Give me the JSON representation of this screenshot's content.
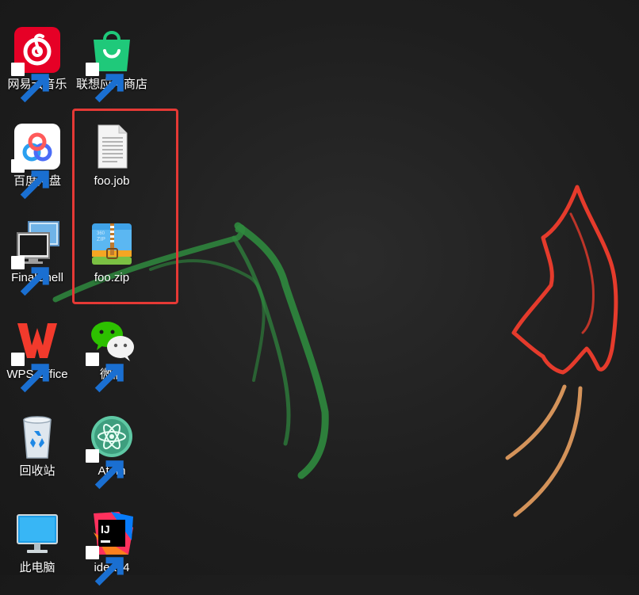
{
  "desktop": {
    "icons": [
      {
        "label": "网易云音乐",
        "icon": "netease-music-icon",
        "shortcut": true
      },
      {
        "label": "联想应用商店",
        "icon": "lenovo-store-icon",
        "shortcut": true
      },
      {
        "label": "百度网盘",
        "icon": "baidu-netdisk-icon",
        "shortcut": true
      },
      {
        "label": "foo.job",
        "icon": "text-file-icon",
        "shortcut": false
      },
      {
        "label": "FinalShell",
        "icon": "finalshell-icon",
        "shortcut": true
      },
      {
        "label": "foo.zip",
        "icon": "zip-archive-icon",
        "shortcut": false
      },
      {
        "label": "WPS Office",
        "icon": "wps-office-icon",
        "shortcut": true
      },
      {
        "label": "微信",
        "icon": "wechat-icon",
        "shortcut": true
      },
      {
        "label": "回收站",
        "icon": "recycle-bin-icon",
        "shortcut": false
      },
      {
        "label": "Atom",
        "icon": "atom-icon",
        "shortcut": true
      },
      {
        "label": "此电脑",
        "icon": "this-pc-icon",
        "shortcut": false
      },
      {
        "label": "idea64",
        "icon": "intellij-idea-icon",
        "shortcut": true
      }
    ],
    "highlight_color": "#e53935"
  },
  "colors": {
    "background": "#1e1e1e",
    "green_stroke": "#2f8a3e",
    "red_flame": "#e53b2c",
    "orange_stroke": "#e8a060"
  }
}
